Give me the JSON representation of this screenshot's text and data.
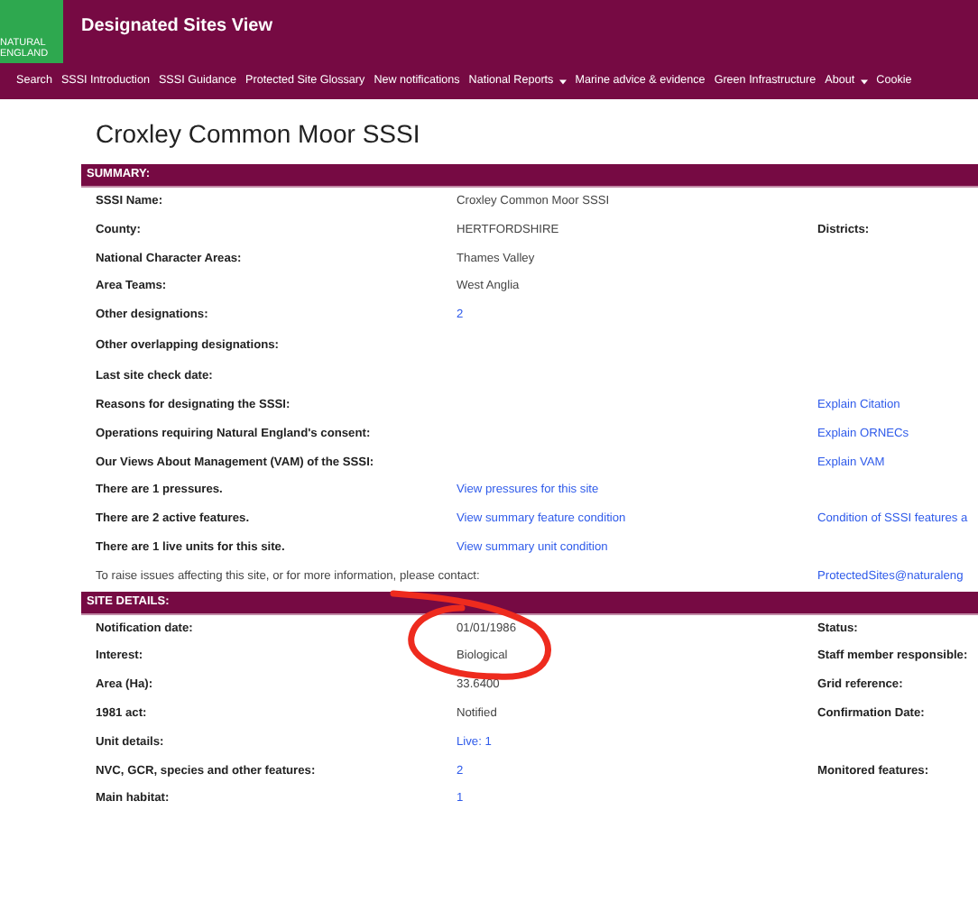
{
  "logo": {
    "lines": [
      "NATURAL",
      "ENGLAND"
    ]
  },
  "site_title": "Designated Sites View",
  "nav": [
    {
      "label": "Search",
      "caret": false
    },
    {
      "label": "SSSI Introduction",
      "caret": false
    },
    {
      "label": "SSSI Guidance",
      "caret": false
    },
    {
      "label": "Protected Site Glossary",
      "caret": false
    },
    {
      "label": "New notifications",
      "caret": false
    },
    {
      "label": "National Reports",
      "caret": true
    },
    {
      "label": "Marine advice & evidence",
      "caret": false
    },
    {
      "label": "Green Infrastructure",
      "caret": false
    },
    {
      "label": "About",
      "caret": true
    },
    {
      "label": "Cookie",
      "caret": false
    }
  ],
  "page_title": "Croxley Common Moor SSSI",
  "sections": [
    {
      "heading": "SUMMARY:",
      "rows": [
        {
          "kind": "field",
          "label": "SSSI Name:",
          "value": {
            "kind": "text",
            "text": "Croxley Common Moor SSSI"
          }
        },
        {
          "kind": "field",
          "label": "County:",
          "value": {
            "kind": "text",
            "text": "HERTFORDSHIRE"
          },
          "side": {
            "kind": "label",
            "text": "Districts:"
          }
        },
        {
          "kind": "field",
          "label": "National Character Areas:",
          "value": {
            "kind": "text",
            "text": "Thames Valley"
          }
        },
        {
          "kind": "field",
          "label": "Area Teams:",
          "value": {
            "kind": "text",
            "text": "West Anglia"
          }
        },
        {
          "kind": "field",
          "label": "Other designations:",
          "value": {
            "kind": "link",
            "text": "2"
          }
        },
        {
          "kind": "field",
          "label": "Other overlapping designations:"
        },
        {
          "kind": "field",
          "label": "Last site check date:"
        },
        {
          "kind": "field",
          "label": "Reasons for designating the SSSI:",
          "side": {
            "kind": "link",
            "text": "Explain Citation"
          }
        },
        {
          "kind": "field",
          "label": "Operations requiring Natural England's consent:",
          "side": {
            "kind": "link",
            "text": "Explain ORNECs"
          }
        },
        {
          "kind": "field",
          "label": "Our Views About Management (VAM) of the SSSI:",
          "side": {
            "kind": "link",
            "text": "Explain VAM"
          }
        },
        {
          "kind": "field",
          "label": "There are 1 pressures.",
          "value": {
            "kind": "link",
            "text": "View pressures for this site"
          }
        },
        {
          "kind": "field",
          "label": "There are 2 active features.",
          "value": {
            "kind": "link",
            "text": "View summary feature condition"
          },
          "side": {
            "kind": "link",
            "text": "Condition of SSSI features a"
          }
        },
        {
          "kind": "field",
          "label": "There are 1 live units for this site.",
          "value": {
            "kind": "link",
            "text": "View summary unit condition"
          }
        },
        {
          "kind": "note",
          "label": "To raise issues affecting this site, or for more information, please contact:",
          "side": {
            "kind": "link",
            "text": "ProtectedSites@naturaleng"
          }
        }
      ]
    },
    {
      "heading": "SITE DETAILS:",
      "rows": [
        {
          "kind": "field",
          "label": "Notification date:",
          "value": {
            "kind": "text",
            "text": "01/01/1986"
          },
          "side": {
            "kind": "label",
            "text": "Status:"
          }
        },
        {
          "kind": "field",
          "label": "Interest:",
          "value": {
            "kind": "text",
            "text": "Biological"
          },
          "side": {
            "kind": "label",
            "text": "Staff member responsible:"
          }
        },
        {
          "kind": "field",
          "label": "Area (Ha):",
          "value": {
            "kind": "text",
            "text": "33.6400"
          },
          "side": {
            "kind": "label",
            "text": "Grid reference:"
          }
        },
        {
          "kind": "field",
          "label": "1981 act:",
          "value": {
            "kind": "text",
            "text": "Notified"
          },
          "side": {
            "kind": "label",
            "text": "Confirmation Date:"
          }
        },
        {
          "kind": "field",
          "label": "Unit details:",
          "value": {
            "kind": "link",
            "text": "Live: 1"
          }
        },
        {
          "kind": "field",
          "label": "NVC, GCR, species and other features:",
          "value": {
            "kind": "link",
            "text": "2"
          },
          "side": {
            "kind": "label",
            "text": "Monitored features:"
          }
        },
        {
          "kind": "field",
          "label": "Main habitat:",
          "value": {
            "kind": "link",
            "text": "1"
          }
        }
      ]
    }
  ]
}
